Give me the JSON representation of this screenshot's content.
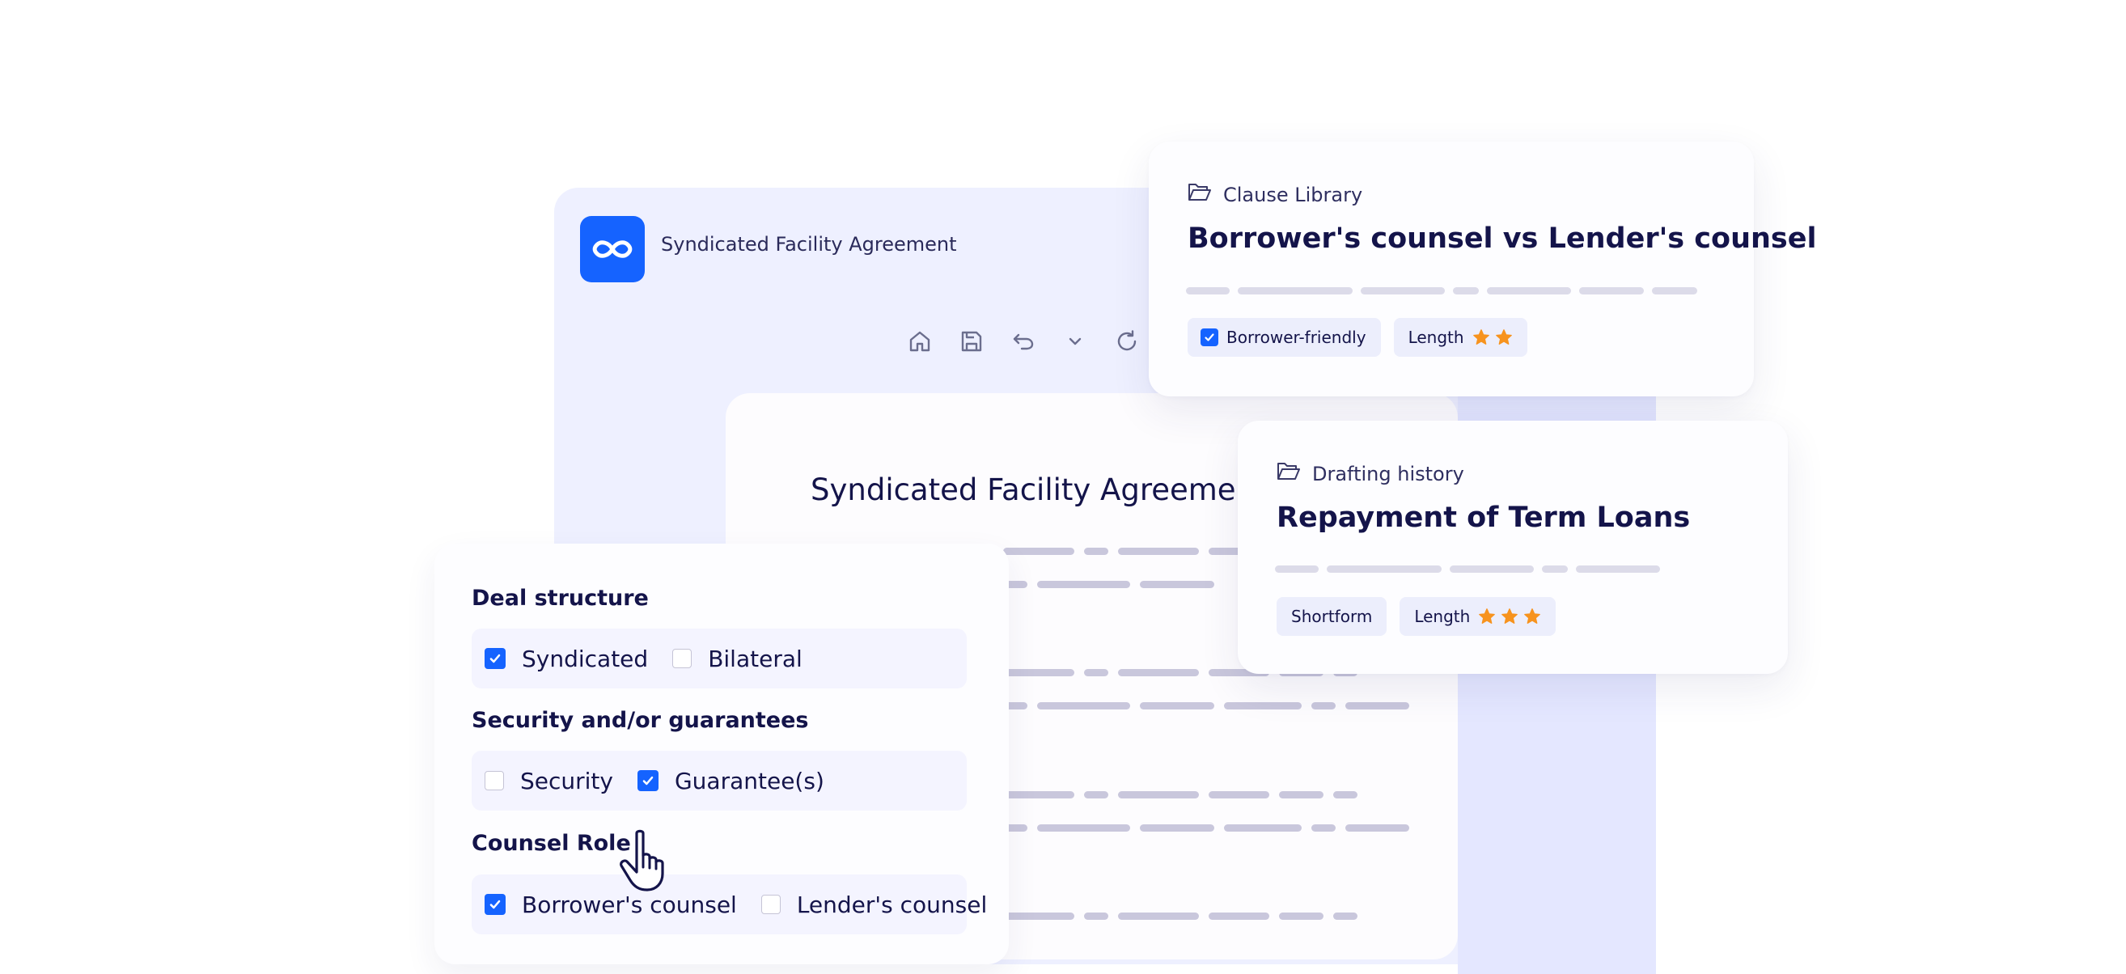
{
  "app": {
    "title": "Syndicated Facility Agreement",
    "logo_icon": "infinity-icon",
    "accent_color": "#1563ff",
    "toolbar": [
      {
        "name": "home-icon"
      },
      {
        "name": "save-icon"
      },
      {
        "name": "undo-icon"
      },
      {
        "name": "chevron-down-icon"
      },
      {
        "name": "refresh-icon"
      }
    ]
  },
  "document": {
    "title": "Syndicated Facility Agreement"
  },
  "clause_library_card": {
    "eyebrow": "Clause Library",
    "eyebrow_icon": "folder-open-icon",
    "heading": "Borrower's counsel vs Lender's counsel",
    "tags": [
      {
        "label": "Borrower-friendly",
        "checked": true
      },
      {
        "label": "Length",
        "stars": 2
      }
    ]
  },
  "drafting_history_card": {
    "eyebrow": "Drafting history",
    "eyebrow_icon": "folder-open-icon",
    "heading": "Repayment of Term Loans",
    "tags": [
      {
        "label": "Shortform"
      },
      {
        "label": "Length",
        "stars": 3
      }
    ],
    "star_color": "#f7931e"
  },
  "form": {
    "sections": [
      {
        "label": "Deal structure",
        "options": [
          {
            "label": "Syndicated",
            "checked": true
          },
          {
            "label": "Bilateral",
            "checked": false
          }
        ]
      },
      {
        "label": "Security and/or guarantees",
        "options": [
          {
            "label": "Security",
            "checked": false
          },
          {
            "label": "Guarantee(s)",
            "checked": true
          }
        ]
      },
      {
        "label": "Counsel Role",
        "options": [
          {
            "label": "Borrower's counsel",
            "checked": true
          },
          {
            "label": "Lender's counsel",
            "checked": false
          }
        ]
      }
    ]
  },
  "cursor_icon": "hand-pointer-icon"
}
